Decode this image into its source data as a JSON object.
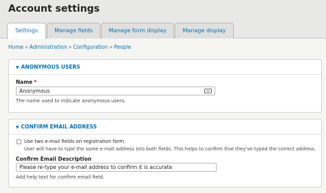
{
  "page": {
    "title": "Account settings"
  },
  "tabs": [
    {
      "label": "Settings",
      "active": true
    },
    {
      "label": "Manage fields",
      "active": false
    },
    {
      "label": "Manage form display",
      "active": false
    },
    {
      "label": "Manage display",
      "active": false
    }
  ],
  "breadcrumb": [
    "Home",
    "Administration",
    "Configuration",
    "People"
  ],
  "breadcrumb_separator": "»",
  "anonymous": {
    "title": "ANONYMOUS USERS",
    "name_label": "Name",
    "required_mark": "*",
    "name_value": "Anonymous",
    "name_desc": "The name used to indicate anonymous users."
  },
  "confirm": {
    "title": "CONFIRM EMAIL ADDRESS",
    "checkbox_label": "Use two e-mail fields on registration form",
    "checkbox_desc": "User will have to type the same e-mail address into both fields. This helps to confirm that they've typed the correct address.",
    "desc_label": "Confirm Email Description",
    "desc_value": "Please re-type your e-mail address to confirm it is accurate",
    "desc_help": "Add help text for confirm email field."
  },
  "colors": {
    "link": "#0074bd",
    "required": "#e00000"
  },
  "icons": {
    "collapse": "triangle-down-icon",
    "field_widget": "keyboard-icon"
  }
}
